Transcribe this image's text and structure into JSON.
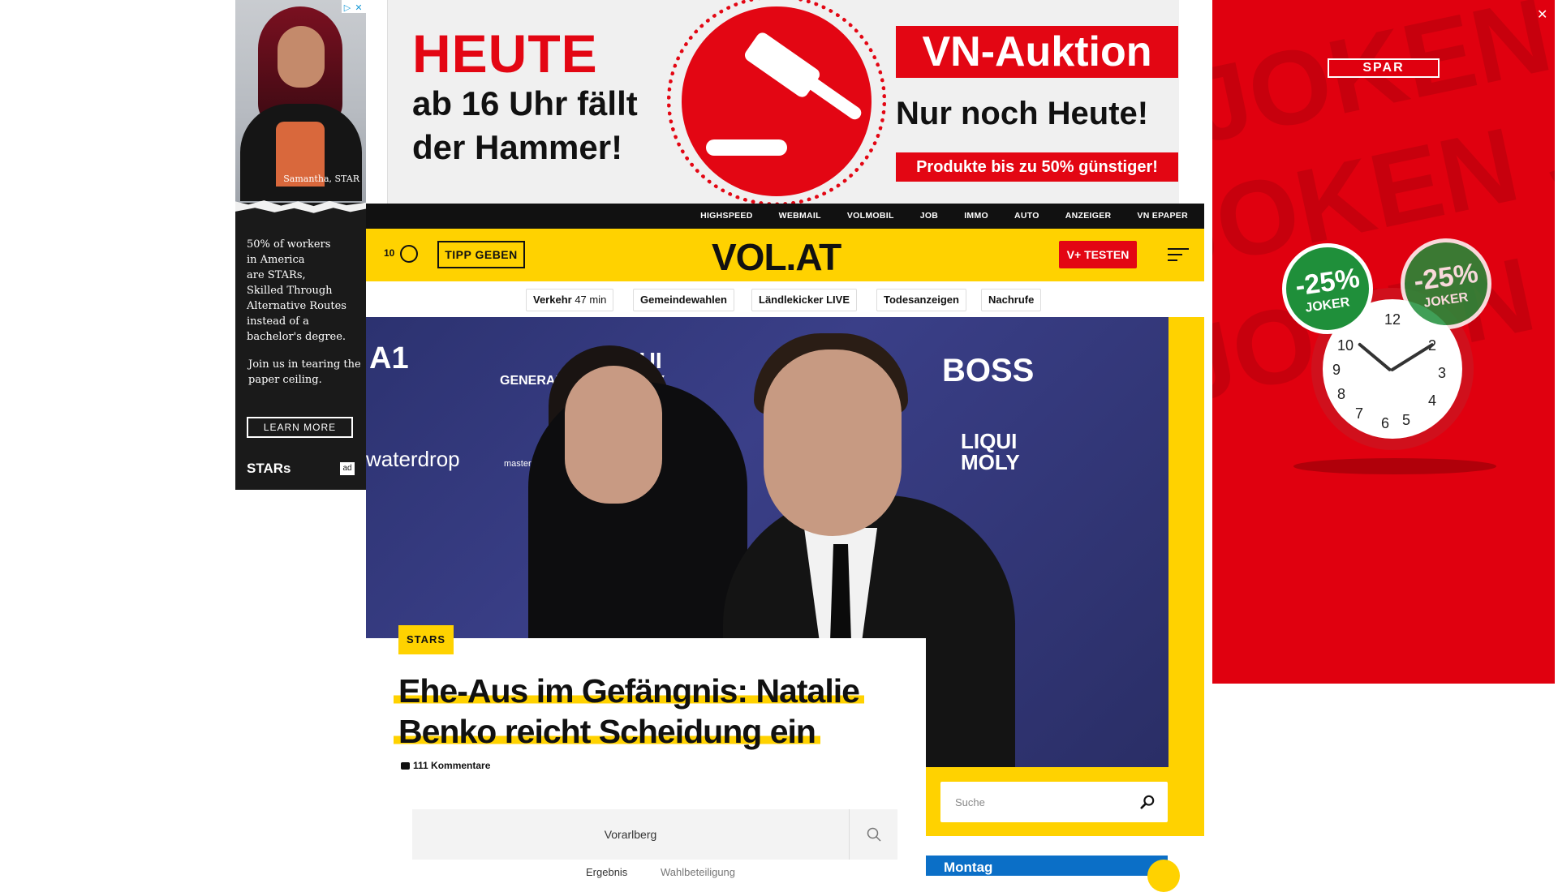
{
  "ad_left": {
    "caption": "Samantha, STAR",
    "copy_lines": [
      "50% of workers",
      "in America",
      "are STARs,",
      "Skilled Through",
      "Alternative Routes",
      "instead of a",
      "bachelor's degree."
    ],
    "copy2": "Join us in tearing the paper ceiling.",
    "cta": "LEARN MORE",
    "brand": "STARs",
    "ad_badge": "ad"
  },
  "banner": {
    "heute": "HEUTE",
    "line1": "ab 16 Uhr fällt",
    "line2": "der Hammer!",
    "title": "VN-Auktion",
    "subtitle": "Nur noch Heute!",
    "offer": "Produkte bis zu 50% günstiger!"
  },
  "ad_right": {
    "brand": "SPAR",
    "badge_pct": "-25%",
    "badge_label": "JOKER",
    "bg_text": "JOKEN JOKEN JOKEN"
  },
  "topnav": [
    "HIGHSPEED",
    "WEBMAIL",
    "VOLMOBIL",
    "JOB",
    "IMMO",
    "AUTO",
    "ANZEIGER",
    "VN EPAPER"
  ],
  "header": {
    "temp": "10",
    "tipp": "TIPP GEBEN",
    "logo": "VOL.AT",
    "vplus": "V+ TESTEN"
  },
  "pills": {
    "verkehr": "Verkehr",
    "verkehr_min": "47 min",
    "gemeindewahlen": "Gemeindewahlen",
    "laendlekicker": "Ländlekicker LIVE",
    "todesanzeigen": "Todesanzeigen",
    "nachrufe": "Nachrufe"
  },
  "hero_logos": {
    "a1": "A1",
    "liqui": "LIQUI MOLY",
    "boss": "BOSS",
    "waterdrop": "waterdrop",
    "mastercard": "mastercard",
    "generali": "GENERALI"
  },
  "article": {
    "kicker": "STARS",
    "headline_line1": "Ehe-Aus im Gefängnis: Natalie",
    "headline_line2": "Benko reicht Scheidung ein",
    "comments": "111 Kommentare"
  },
  "search": {
    "placeholder": "Suche"
  },
  "vote": {
    "region": "Vorarlberg",
    "tab_ergebnis": "Ergebnis",
    "tab_wahlbeteiligung": "Wahlbeteiligung"
  },
  "weather": {
    "day": "Montag"
  },
  "colors": {
    "brand_yellow": "#ffd200",
    "accent_red": "#e30613",
    "spar_red": "#e0000f"
  }
}
